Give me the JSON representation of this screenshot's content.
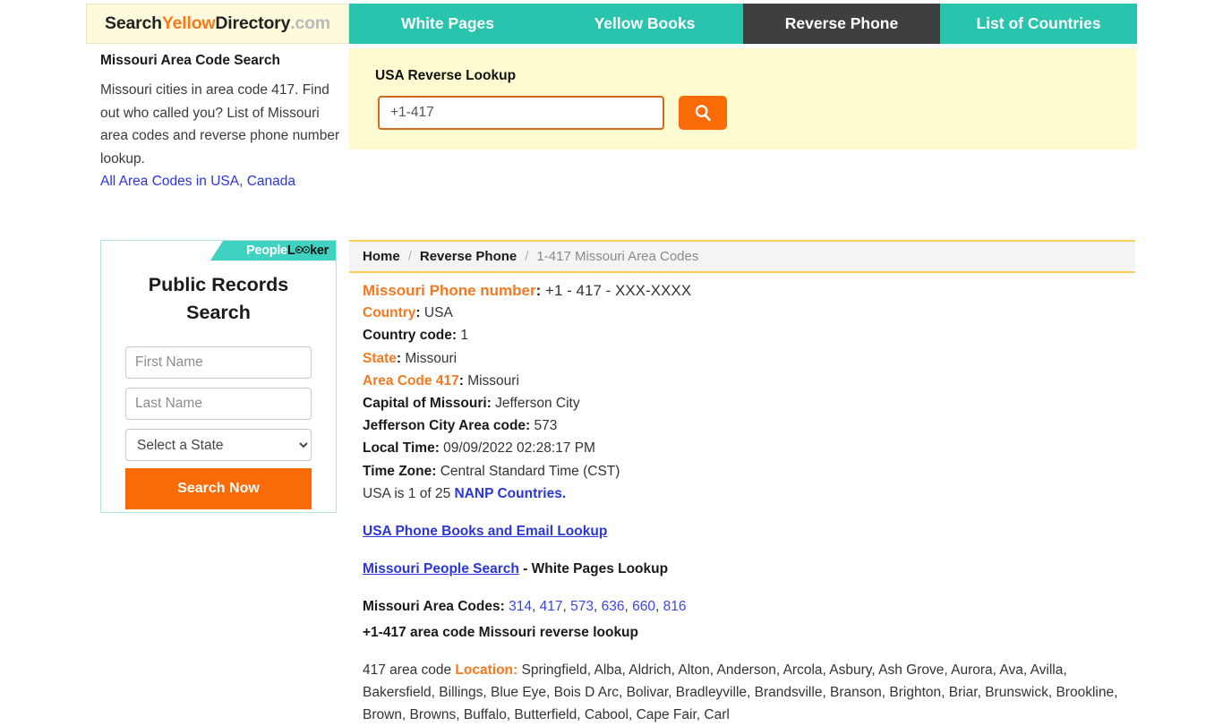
{
  "header": {
    "logo": {
      "part1": "Search",
      "part2": "Yellow",
      "part3": "Directory",
      "part4": ".com"
    },
    "nav": [
      {
        "label": "White Pages",
        "active": false
      },
      {
        "label": "Yellow Books",
        "active": false
      },
      {
        "label": "Reverse Phone",
        "active": true
      },
      {
        "label": "List of Countries",
        "active": false
      }
    ]
  },
  "sidebar": {
    "title": "Missouri Area Code Search",
    "description": "Missouri cities in area code 417. Find out who called you? List of Missouri area codes and reverse phone number lookup.",
    "link": "All Area Codes in USA, Canada"
  },
  "lookup": {
    "title": "USA Reverse Lookup",
    "input_value": "",
    "placeholder": "+1-417",
    "search_icon": "search-icon",
    "button_color": "#f96b07"
  },
  "widget": {
    "brand_people": "People",
    "brand_looker_pre": "L",
    "brand_looker_post": "ker",
    "heading": "Public Records Search",
    "first_name_placeholder": "First Name",
    "last_name_placeholder": "Last Name",
    "state_selected": "Select a State",
    "state_options": [
      "Select a State"
    ],
    "submit_label": "Search Now"
  },
  "breadcrumb": {
    "home": "Home",
    "section": "Reverse Phone",
    "current": "1-417 Missouri Area Codes",
    "separator": "/"
  },
  "details": {
    "phone_label": "Missouri Phone number",
    "phone_value": "+1 - 417 - XXX-XXXX",
    "country_label": "Country",
    "country_value": "USA",
    "country_code_label": "Country code",
    "country_code_value": "1",
    "state_label": "State",
    "state_value": "Missouri",
    "area_code_label": "Area Code 417",
    "area_code_value": "Missouri",
    "capital_label": "Capital of Missouri",
    "capital_value": "Jefferson City",
    "capital_ac_label": "Jefferson City Area code",
    "capital_ac_value": "573",
    "local_time_label": "Local Time",
    "local_time_value": "09/09/2022 02:28:17 PM",
    "time_zone_label": "Time Zone",
    "time_zone_value": "Central Standard Time (CST)",
    "nanp_prefix": "USA is 1 of 25 ",
    "nanp_link": "NANP Countries.",
    "colon": ":"
  },
  "links": {
    "phone_books": "USA Phone Books and Email Lookup",
    "people_search": "Missouri People Search",
    "people_search_suffix": " - White Pages Lookup",
    "area_codes_label": "Missouri Area Codes:",
    "area_codes": [
      "314",
      "417",
      "573",
      "636",
      "660",
      "816"
    ],
    "reverse_lookup_line": "+1-417 area code Missouri reverse lookup"
  },
  "location": {
    "prefix": "417 area code ",
    "label": "Location:",
    "cities": "Springfield, Alba, Aldrich, Alton, Anderson, Arcola, Asbury, Ash Grove, Aurora, Ava, Avilla, Bakersfield, Billings, Blue Eye, Bois D Arc, Bolivar, Bradleyville, Brandsville, Branson, Brighton, Briar, Brunswick, Brookline, Brown, Browns, Buffalo, Butterfield, Cabool, Cape Fair, Carl"
  },
  "colors": {
    "nav_teal": "#28c4ae",
    "nav_active": "#3f3f3f",
    "accent_orange": "#f47920",
    "button_orange": "#f96b07",
    "link_blue": "#2b36d8",
    "panel_yellow": "#fdfbcf",
    "widget_teal": "#3fd2c0"
  }
}
